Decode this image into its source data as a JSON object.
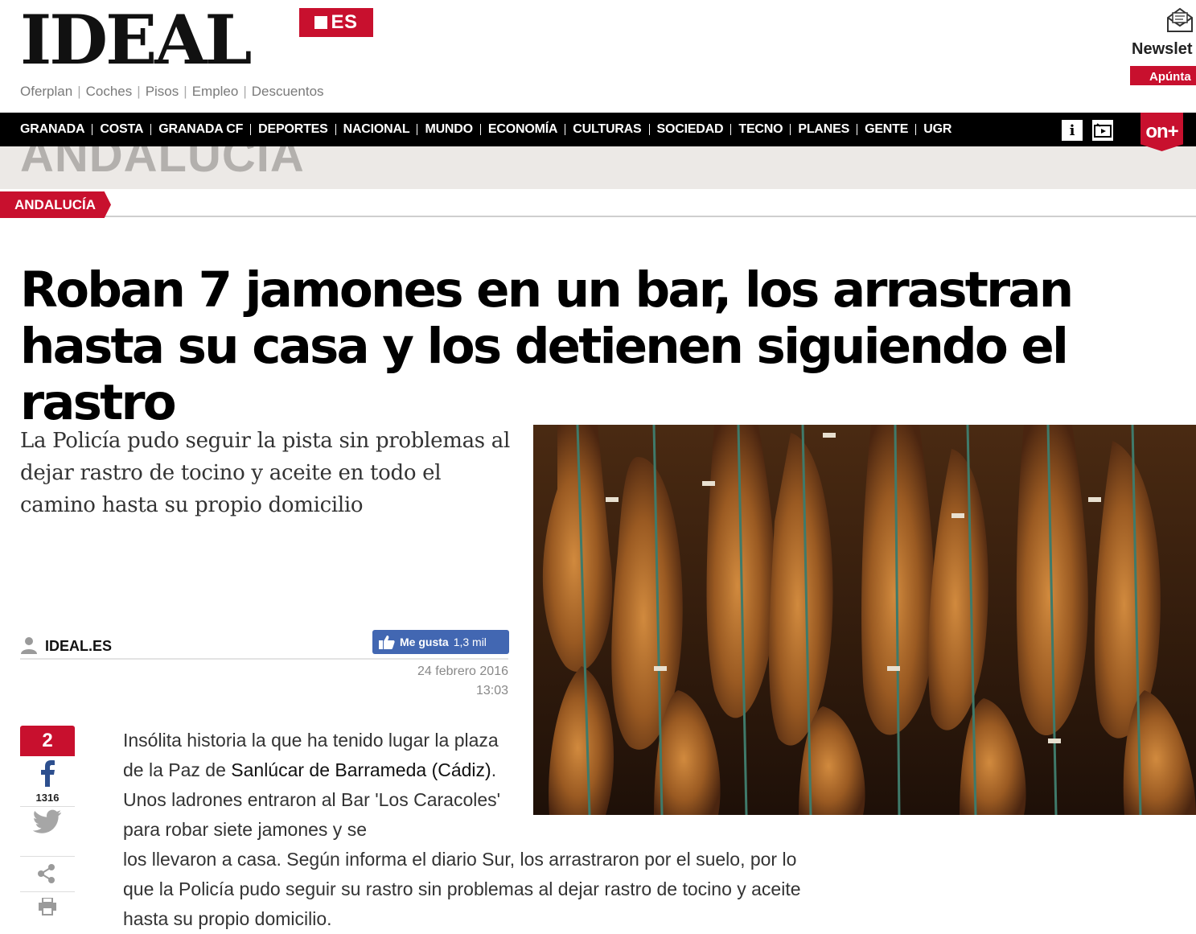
{
  "header": {
    "logo": "IDEAL",
    "logo_badge": "ES",
    "service_links": [
      "Oferplan",
      "Coches",
      "Pisos",
      "Empleo",
      "Descuentos"
    ],
    "newsletter_label": "Newslet",
    "newsletter_button": "Apúnta"
  },
  "nav": {
    "items": [
      "GRANADA",
      "COSTA",
      "GRANADA CF",
      "DEPORTES",
      "NACIONAL",
      "MUNDO",
      "ECONOMÍA",
      "CULTURAS",
      "SOCIEDAD",
      "TECNO",
      "PLANES",
      "GENTE",
      "UGR"
    ],
    "onplus": "on+"
  },
  "section": {
    "band_title": "ANDALUCÍA",
    "tag": "ANDALUCÍA"
  },
  "article": {
    "headline": "Roban 7 jamones en un bar, los arrastran hasta su casa y los detienen siguiendo el rastro",
    "subtitle": "La Policía pudo seguir la pista sin problemas al dejar rastro de tocino y aceite en todo el camino hasta su propio domicilio",
    "author": "IDEAL.ES",
    "fb_like_label": "Me gusta",
    "fb_like_count": "1,3 mil",
    "date": "24 febrero 2016",
    "time": "13:03",
    "body": {
      "p1_a": "Insólita historia la que ha tenido lugar la plaza de la Paz de ",
      "p1_strong": "Sanlúcar de Barrameda (Cádiz)",
      "p1_b": ". Unos ladrones entraron al Bar 'Los Caracoles' para robar siete jamones y se",
      "p2": "los llevaron a casa. Según informa el diario Sur, los arrastraron por el suelo, por lo que la Policía pudo seguir su rastro sin problemas al dejar rastro de tocino y aceite hasta su propio domicilio."
    }
  },
  "share": {
    "count": "2",
    "facebook_count": "1316"
  }
}
